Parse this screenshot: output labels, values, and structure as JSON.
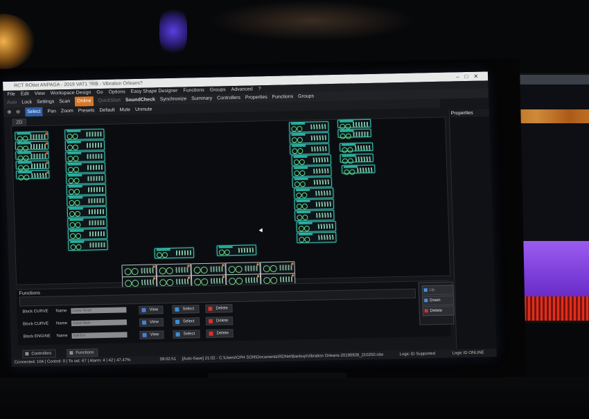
{
  "window": {
    "title": "RCT ROtiet ANPAGA - 2019 VAT1 ?RB - Vibration Orleans?"
  },
  "menu": [
    "File",
    "Edit",
    "View",
    "Workspace Design",
    "Go",
    "Options",
    "Easy Shape Designer",
    "Functions",
    "Groups",
    "Advanced",
    "?"
  ],
  "toolbar1": {
    "auto": "Auto",
    "lock": "Lock",
    "settings": "Settings",
    "scan": "Scan",
    "offline": "Online",
    "quickstart": "QuickStart",
    "soundcheck": "SoundCheck",
    "synchronize": "Synchronize",
    "summary": "Summary",
    "controllers": "Controllers",
    "properties": "Properties",
    "functions": "Functions",
    "groups": "Groups"
  },
  "toolbar2": {
    "select": "Select",
    "pan": "Pan",
    "zoom": "Zoom",
    "presets": "Presets",
    "default": "Default",
    "mute": "Mute",
    "unmute": "Unmute"
  },
  "workspace_tab": "2D",
  "properties_panel": {
    "title": "Properties"
  },
  "functions_panel": {
    "title": "Functions",
    "rows": [
      {
        "label": "Block CURVE",
        "name_label": "Name",
        "name_value": "Curve Small",
        "view": "View",
        "select": "Select",
        "delete": "Delete"
      },
      {
        "label": "Block CURVE",
        "name_label": "Name",
        "name_value": "Curve Main",
        "view": "View",
        "select": "Select",
        "delete": "Delete"
      },
      {
        "label": "Block ENGINE",
        "name_label": "Name",
        "name_value": "Sub Ext",
        "view": "View",
        "select": "Select",
        "delete": "Delete"
      }
    ],
    "side_buttons": {
      "up": "Up",
      "down": "Down",
      "delete": "Delete"
    }
  },
  "bottom_tabs": [
    "Controllers",
    "Functions"
  ],
  "status": {
    "left": "Connected: 104 | Control: 0 | To set: 67 | Alarm: 4 | 42 | 47.47%",
    "time": "09:02:51",
    "path": "[Auto-Save] 21:02 - C:\\Users\\CPH SON\\Documents\\RDNet\\Backup\\Vibration Orleans-20190928_210250.rdw",
    "logic_support": "Logic ID Supported",
    "logic_online": "Logic ID  ONLINE"
  },
  "colors": {
    "device_border": "#3fc4b4",
    "offline_button": "#d8782a",
    "delete_icon": "#d83030",
    "accent_blue": "#2d5fa8"
  }
}
